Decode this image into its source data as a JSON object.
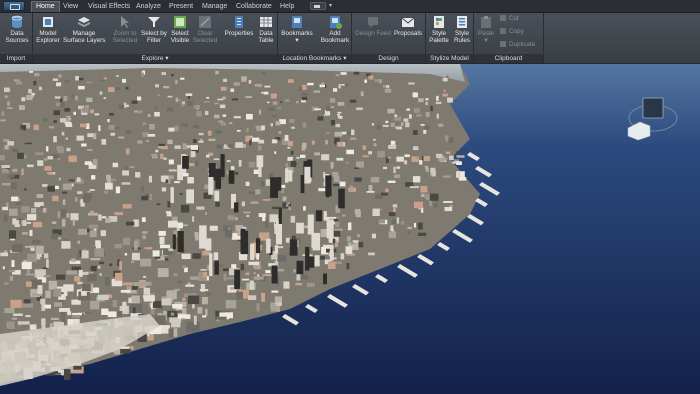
{
  "tabs": [
    "Home",
    "View",
    "Visual Effects",
    "Analyze",
    "Present",
    "Manage",
    "Collaborate",
    "Help"
  ],
  "active_tab": "Home",
  "panels": {
    "import": "Import",
    "explore": "Explore",
    "location_bookmarks": "Location Bookmarks",
    "design": "Design",
    "stylize_model": "Stylize Model",
    "clipboard": "Clipboard"
  },
  "buttons": {
    "data_sources": [
      "Data",
      "Sources"
    ],
    "model_explorer": [
      "Model",
      "Explorer"
    ],
    "manage_surface_layers": [
      "Manage",
      "Surface Layers"
    ],
    "zoom_to_selected": [
      "Zoom to",
      "Selected"
    ],
    "select_by_filter": [
      "Select by",
      "Filter"
    ],
    "select_visible": [
      "Select",
      "Visible"
    ],
    "clear_selected": [
      "Clear",
      "Selected"
    ],
    "properties": "Properties",
    "data_table": [
      "Data",
      "Table"
    ],
    "bookmarks": "Bookmarks",
    "add_bookmark": [
      "Add",
      "Bookmark"
    ],
    "design_feed": "Design Feed",
    "proposals": "Proposals",
    "style_palette": [
      "Style",
      "Palette"
    ],
    "style_rules": [
      "Style",
      "Rules"
    ],
    "paste": "Paste",
    "cut": "Cut",
    "copy": "Copy",
    "duplicate": "Duplicate"
  },
  "colors": {
    "ribbon": "#43484f",
    "panel_title_bar": "#2f3338",
    "ocean": "#1a2c5a",
    "haze": "#b9c6cf",
    "land": "#8a8276"
  }
}
